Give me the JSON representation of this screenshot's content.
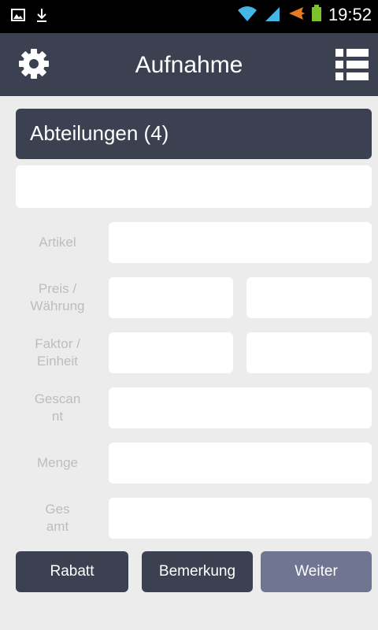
{
  "status_bar": {
    "time": "19:52",
    "left_icons": [
      "gallery-icon",
      "download-icon"
    ],
    "right_icons": [
      "wifi-icon",
      "signal-icon",
      "airplane-icon",
      "battery-icon"
    ]
  },
  "app_bar": {
    "title": "Aufnahme",
    "left_icon": "gear-icon",
    "right_icon": "list-menu-icon"
  },
  "section": {
    "header": "Abteilungen (4)"
  },
  "form": {
    "artikel_label": "Artikel",
    "preis_label": "Preis / Währung",
    "faktor_label": "Faktor / Einheit",
    "gescannt_label": "Gescannt",
    "menge_label": "Menge",
    "gesamt_label": "Gesamt"
  },
  "buttons": {
    "rabatt": "Rabatt",
    "bemerkung": "Bemerkung",
    "weiter": "Weiter"
  },
  "colors": {
    "primary": "#3b4150",
    "secondary_button": "#707691",
    "background": "#ececec",
    "label": "#bdbdbd"
  }
}
